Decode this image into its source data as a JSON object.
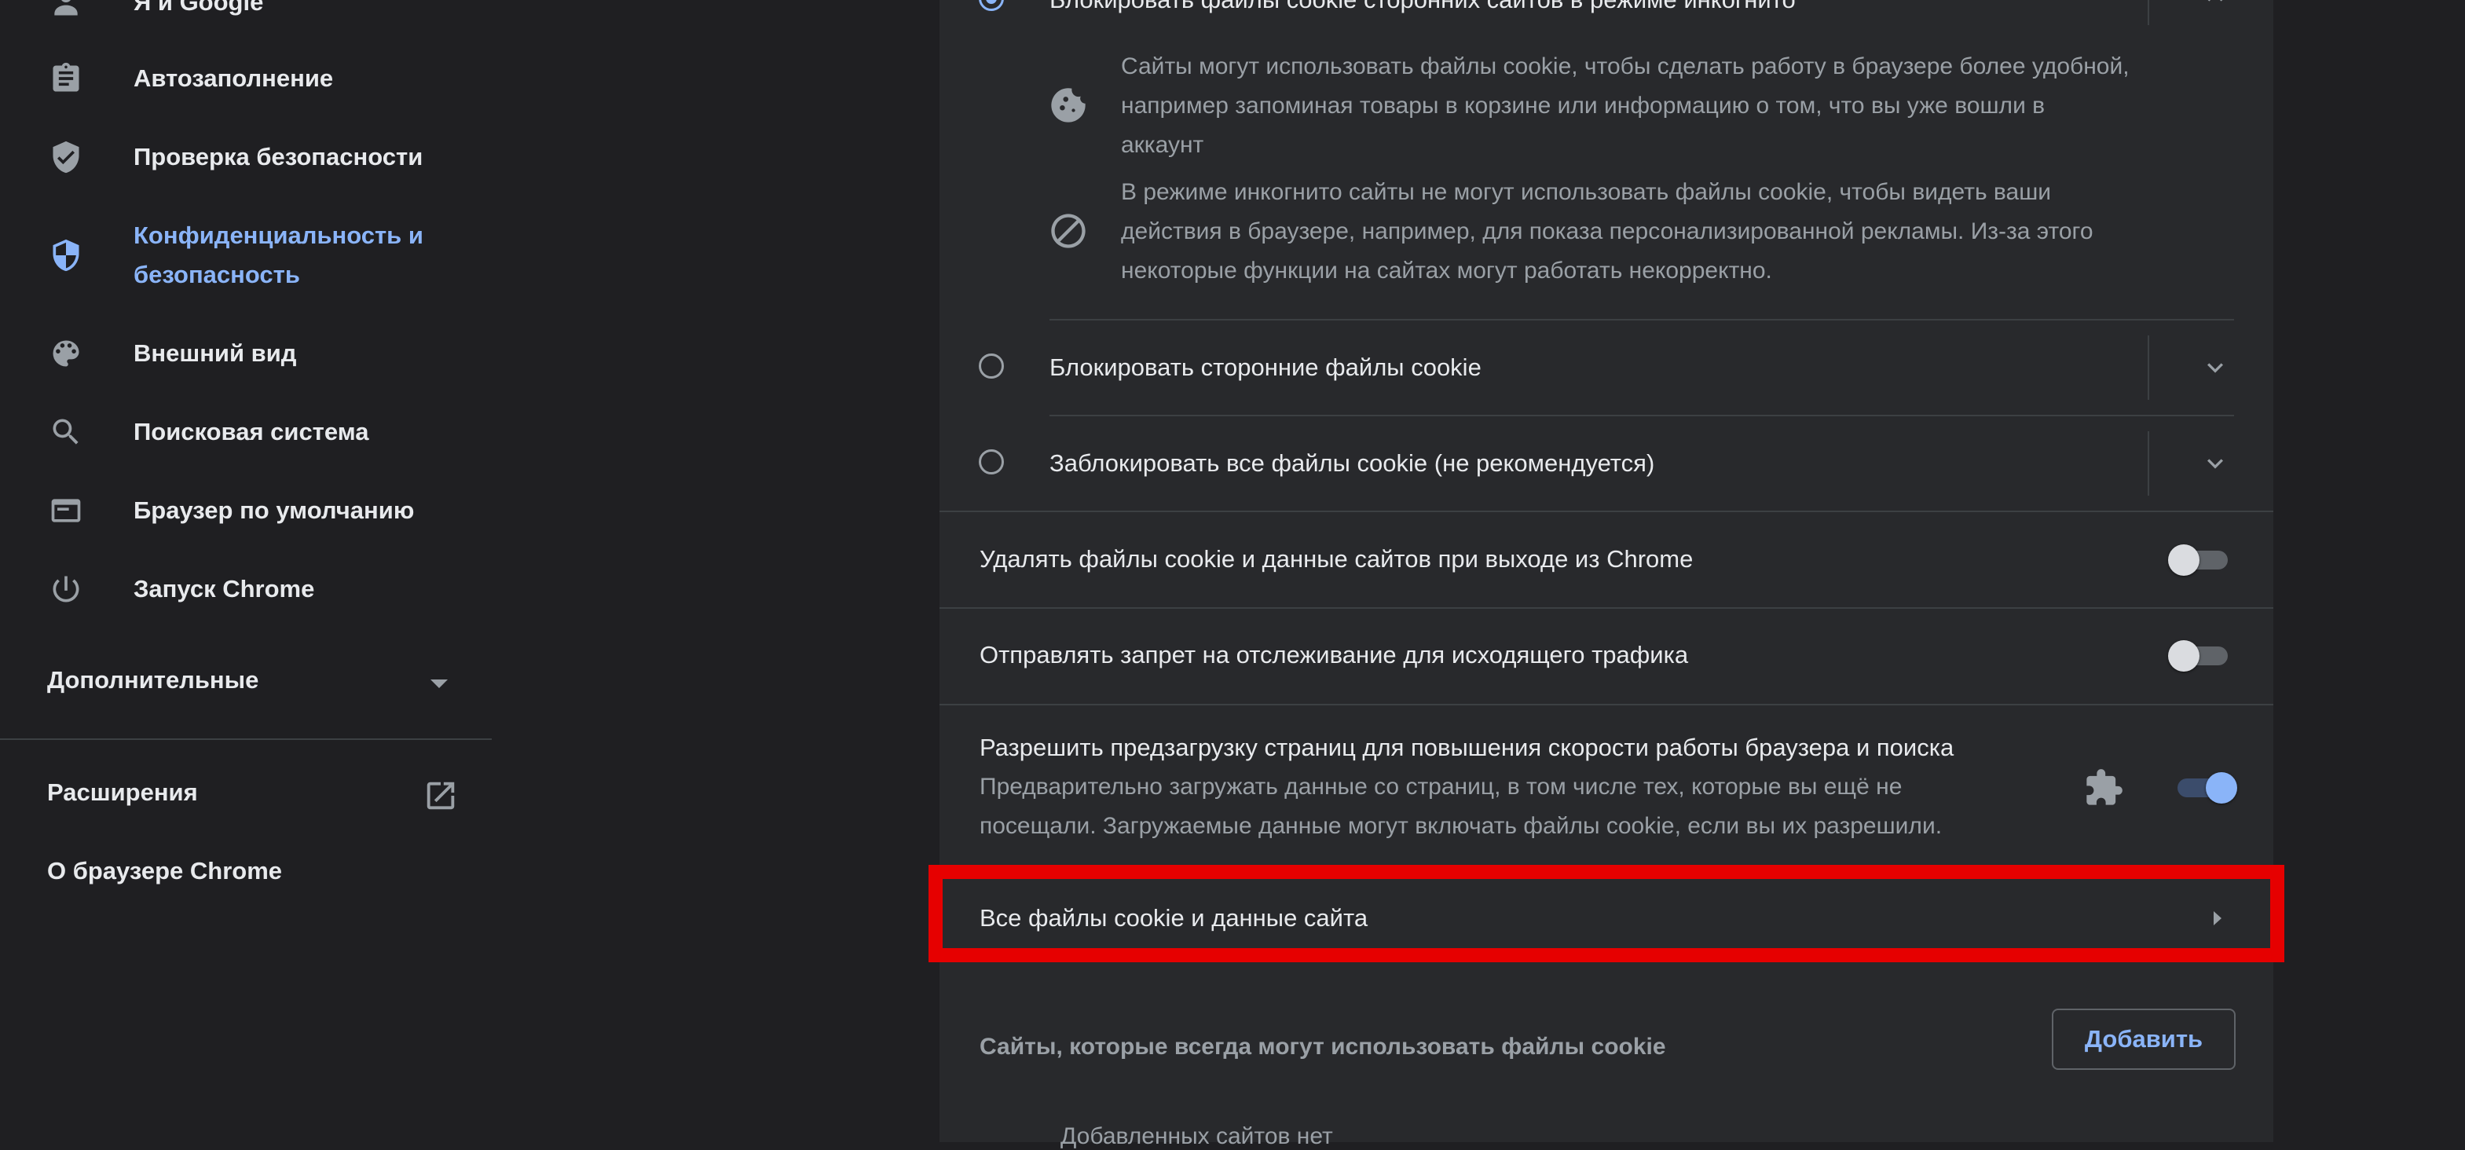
{
  "sidebar": {
    "items": [
      {
        "label": "Я и Google",
        "icon": "person-icon"
      },
      {
        "label": "Автозаполнение",
        "icon": "clipboard-icon"
      },
      {
        "label": "Проверка безопасности",
        "icon": "shield-check-icon"
      },
      {
        "label": "Конфиденциальность и",
        "label2": "безопасность",
        "icon": "shield-half-icon",
        "active": true
      },
      {
        "label": "Внешний вид",
        "icon": "palette-icon"
      },
      {
        "label": "Поисковая система",
        "icon": "search-icon"
      },
      {
        "label": "Браузер по умолчанию",
        "icon": "browser-window-icon"
      },
      {
        "label": "Запуск Chrome",
        "icon": "power-icon"
      }
    ],
    "advanced": "Дополнительные",
    "extensions": "Расширения",
    "about": "О браузере Chrome"
  },
  "cookies": {
    "option_incognito": {
      "label": "Блокировать файлы cookie сторонних сайтов в режиме инкогнито",
      "selected": true,
      "desc1": "Сайты могут использовать файлы cookie, чтобы сделать работу в браузере более удобной,",
      "desc1b": "например запоминая товары в корзине или информацию о том, что вы уже вошли в",
      "desc1c": "аккаунт",
      "desc2": "В режиме инкогнито сайты не могут использовать файлы cookie, чтобы видеть ваши",
      "desc2b": "действия в браузере, например, для показа персонализированной рекламы. Из-за этого",
      "desc2c": "некоторые функции на сайтах могут работать некорректно."
    },
    "option_third_party": {
      "label": "Блокировать сторонние файлы cookie",
      "selected": false
    },
    "option_all": {
      "label": "Заблокировать все файлы cookie (не рекомендуется)",
      "selected": false
    },
    "clear_on_exit": {
      "label": "Удалять файлы cookie и данные сайтов при выходе из Chrome",
      "enabled": false
    },
    "do_not_track": {
      "label": "Отправлять запрет на отслеживание для исходящего трафика",
      "enabled": false
    },
    "preload": {
      "label": "Разрешить предзагрузку страниц для повышения скорости работы браузера и поиска",
      "desc1": "Предварительно загружать данные со страниц, в том числе тех, которые вы ещё не",
      "desc2": "посещали. Загружаемые данные могут включать файлы cookie, если вы их разрешили.",
      "enabled": true
    },
    "all_cookies_link": "Все файлы cookie и данные сайта",
    "allowed_sites": {
      "label": "Сайты, которые всегда могут использовать файлы cookie",
      "add_button": "Добавить",
      "empty_text": "Добавленных сайтов нет"
    }
  },
  "colors": {
    "accent": "#8ab4f8",
    "highlight": "#e60000",
    "background": "#1f1f22",
    "card": "#28292c"
  }
}
